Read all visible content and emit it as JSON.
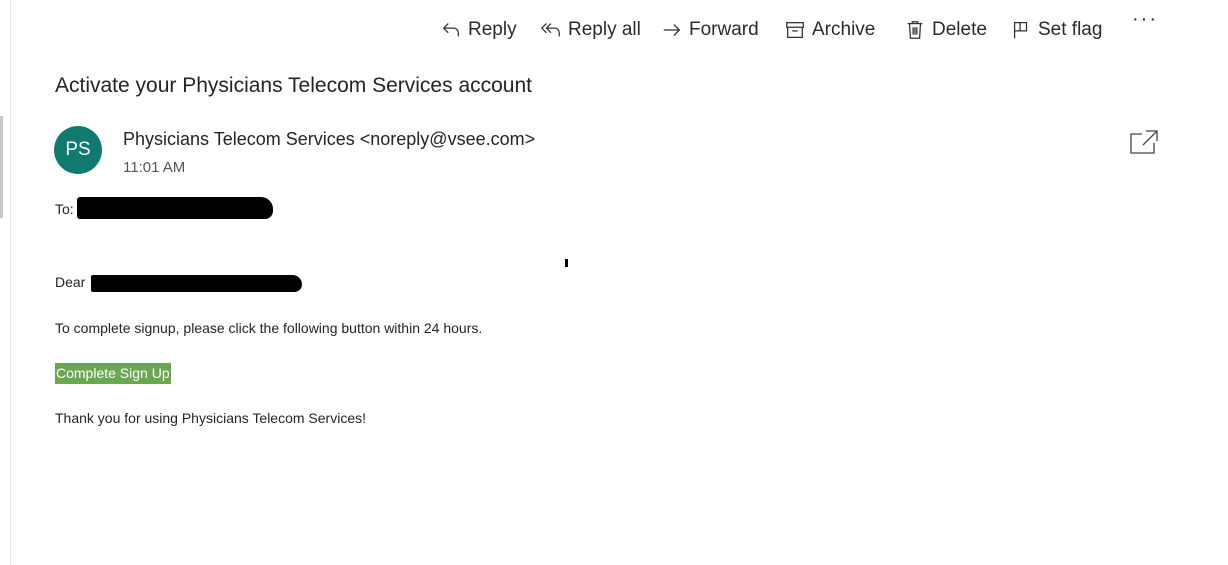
{
  "toolbar": {
    "reply_label": "Reply",
    "reply_all_label": "Reply all",
    "forward_label": "Forward",
    "archive_label": "Archive",
    "delete_label": "Delete",
    "set_flag_label": "Set flag",
    "more_label": "···"
  },
  "message": {
    "subject": "Activate your Physicians Telecom Services account",
    "avatar_initials": "PS",
    "avatar_color": "#0f7a70",
    "sender": "Physicians Telecom Services <noreply@vsee.com>",
    "time": "11:01 AM",
    "to_label": "To:",
    "greeting": "Dear",
    "body": "To complete signup, please click the following button within 24 hours.",
    "cta_label": "Complete Sign Up",
    "cta_color": "#6aa84f",
    "closing": "Thank you for using Physicians Telecom Services!"
  }
}
